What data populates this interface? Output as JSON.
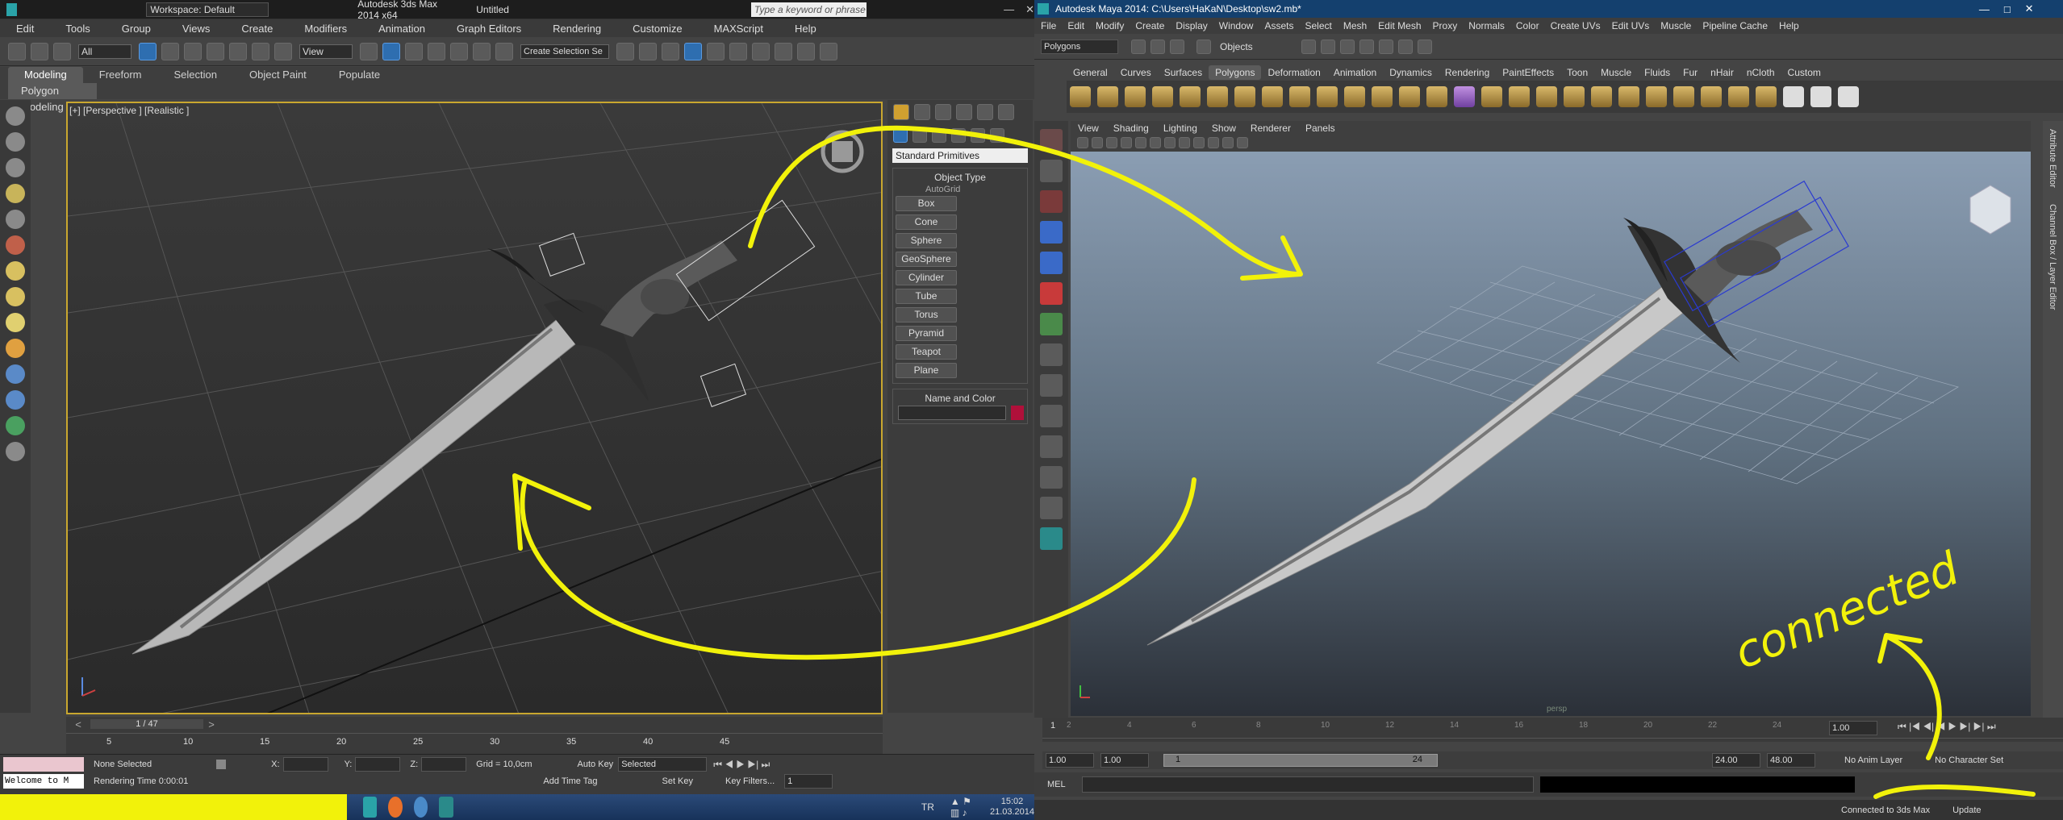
{
  "max": {
    "workspace": "Workspace: Default",
    "app_title": "Autodesk 3ds Max  2014 x64",
    "doc_title": "Untitled",
    "search_placeholder": "Type a keyword or phrase",
    "menu": [
      "Edit",
      "Tools",
      "Group",
      "Views",
      "Create",
      "Modifiers",
      "Animation",
      "Graph Editors",
      "Rendering",
      "Customize",
      "MAXScript",
      "Help"
    ],
    "filter": "All",
    "ref_coord": "View",
    "selection_set": "Create Selection Se",
    "ribbon_tabs": [
      "Modeling",
      "Freeform",
      "Selection",
      "Object Paint",
      "Populate"
    ],
    "ribbon_sub": "Polygon Modeling",
    "viewport_label": "[+] [Perspective ] [Realistic ]",
    "primitive_dropdown": "Standard Primitives",
    "object_type_title": "Object Type",
    "autogrid": "AutoGrid",
    "primitives": [
      "Box",
      "Cone",
      "Sphere",
      "GeoSphere",
      "Cylinder",
      "Tube",
      "Torus",
      "Pyramid",
      "Teapot",
      "Plane"
    ],
    "name_color_title": "Name and Color",
    "frame_counter": "1 / 47",
    "timeline_ticks": [
      "5",
      "10",
      "15",
      "20",
      "25",
      "30",
      "35",
      "40",
      "45"
    ],
    "status_selected": "None Selected",
    "rendering_time": "Rendering Time  0:00:01",
    "coord_x": "X:",
    "coord_y": "Y:",
    "coord_z": "Z:",
    "grid": "Grid = 10,0cm",
    "add_time_tag": "Add Time Tag",
    "auto_key": "Auto Key",
    "set_key": "Set Key",
    "key_mode": "Selected",
    "key_filters": "Key Filters...",
    "frame_field": "1",
    "maxscript_listener": "Welcome to M"
  },
  "taskbar": {
    "lang": "TR",
    "time": "15:02",
    "date": "21.03.2014"
  },
  "maya": {
    "title": "Autodesk Maya 2014: C:\\Users\\HaKaN\\Desktop\\sw2.mb*",
    "menu": [
      "File",
      "Edit",
      "Modify",
      "Create",
      "Display",
      "Window",
      "Assets",
      "Select",
      "Mesh",
      "Edit Mesh",
      "Proxy",
      "Normals",
      "Color",
      "Create UVs",
      "Edit UVs",
      "Muscle",
      "Pipeline Cache",
      "Help"
    ],
    "menu_set": "Polygons",
    "objects": "Objects",
    "shelf_tabs": [
      "General",
      "Curves",
      "Surfaces",
      "Polygons",
      "Deformation",
      "Animation",
      "Dynamics",
      "Rendering",
      "PaintEffects",
      "Toon",
      "Muscle",
      "Fluids",
      "Fur",
      "nHair",
      "nCloth",
      "Custom"
    ],
    "viewport_menu": [
      "View",
      "Shading",
      "Lighting",
      "Show",
      "Renderer",
      "Panels"
    ],
    "camera_label": "persp",
    "timeline_ticks": [
      "1",
      "2",
      "4",
      "6",
      "8",
      "10",
      "12",
      "14",
      "16",
      "18",
      "20",
      "22",
      "24"
    ],
    "current_frame": "1.00",
    "range_start": "1.00",
    "range_playback_start": "1.00",
    "range_slider_start": "1",
    "range_slider_end": "24",
    "range_playback_end": "24.00",
    "range_end": "48.00",
    "anim_layer": "No Anim Layer",
    "character_set": "No Character Set",
    "mel_label": "MEL",
    "help_line": "Connected to 3ds Max",
    "update": "Update",
    "side_tabs": [
      "Attribute Editor",
      "Channel Box / Layer Editor"
    ]
  },
  "annotation": {
    "handwritten": "connected",
    "stroke_color": "#f2f20a"
  },
  "colors": {
    "max_bg": "#444444",
    "maya_title": "#14406e",
    "accent_yellow": "#f2f20a",
    "swatch_red": "#b0103a"
  }
}
